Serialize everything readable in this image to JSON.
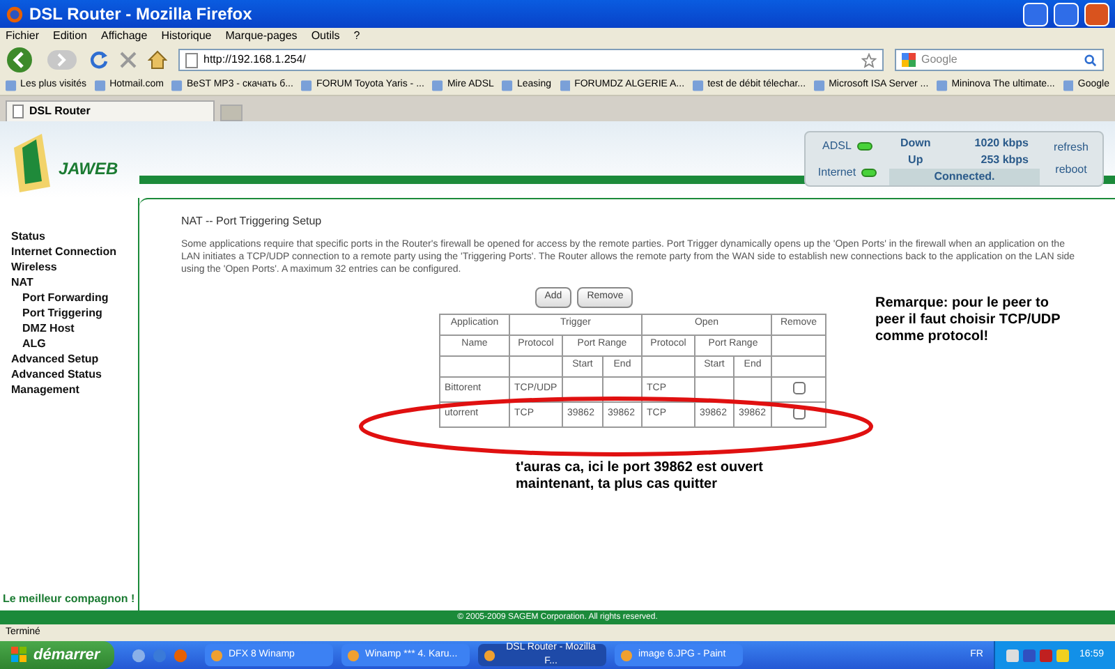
{
  "window": {
    "title": "DSL Router - Mozilla Firefox"
  },
  "menu": [
    "Fichier",
    "Edition",
    "Affichage",
    "Historique",
    "Marque-pages",
    "Outils",
    "?"
  ],
  "navigation": {
    "url": "http://192.168.1.254/",
    "search_placeholder": "Google"
  },
  "bookmarks": [
    "Les plus visités",
    "Hotmail.com",
    "BeST MP3 - скачать б...",
    "FORUM Toyota Yaris - ...",
    "Mire ADSL",
    "Leasing",
    "FORUMDZ ALGERIE A...",
    "test de débit télechar...",
    "Microsoft ISA Server ...",
    "Mininova  The ultimate...",
    "Google"
  ],
  "tabs": [
    {
      "label": "DSL Router",
      "selected": true
    }
  ],
  "router": {
    "logo": "JAWEB",
    "status": {
      "adsl_label": "ADSL",
      "internet_label": "Internet",
      "down_label": "Down",
      "down_value": "1020 kbps",
      "up_label": "Up",
      "up_value": "253 kbps",
      "connection": "Connected.",
      "buttons": [
        "refresh",
        "reboot"
      ]
    },
    "sidebar": {
      "items": [
        {
          "label": "Status"
        },
        {
          "label": "Internet Connection"
        },
        {
          "label": "Wireless"
        },
        {
          "label": "NAT",
          "children": [
            {
              "label": "Port Forwarding"
            },
            {
              "label": "Port Triggering"
            },
            {
              "label": "DMZ Host"
            },
            {
              "label": "ALG"
            }
          ]
        },
        {
          "label": "Advanced Setup"
        },
        {
          "label": "Advanced Status"
        },
        {
          "label": "Management"
        }
      ],
      "slogan": "Le meilleur compagnon !"
    },
    "page_title": "NAT -- Port Triggering Setup",
    "description": "Some applications require that specific ports in the Router's firewall be opened for access by the remote parties. Port Trigger dynamically opens up the 'Open Ports' in the firewall when an application on the LAN initiates a TCP/UDP connection to a remote party using the 'Triggering Ports'. The Router allows the remote party from the WAN side to establish new connections back to the application on the LAN side using the 'Open Ports'. A maximum 32 entries can be configured.",
    "buttons": [
      "Add",
      "Remove"
    ],
    "table": {
      "header": {
        "application": "Application",
        "trigger": "Trigger",
        "open": "Open",
        "remove": "Remove",
        "name": "Name",
        "trigger_protocol": "Protocol",
        "trigger_port_range": "Port Range",
        "open_protocol": "Protocol",
        "open_port_range": "Port Range",
        "trigger_start": "Start",
        "trigger_end": "End",
        "open_start": "Start",
        "open_end": "End"
      },
      "rows": [
        {
          "name": "Bittorent",
          "trigger_protocol": "TCP/UDP",
          "open_protocol": "TCP",
          "checked": false
        },
        {
          "name": "utorrent",
          "trigger_protocol": "TCP",
          "trigger_start": "39862",
          "trigger_end": "39862",
          "open_protocol": "TCP",
          "open_start": "39862",
          "open_end": "39862",
          "checked": false
        }
      ]
    },
    "footer": "© 2005-2009 SAGEM Corporation. All rights reserved."
  },
  "annotations": {
    "note": "Remarque: pour le peer to peer il faut choisir TCP/UDP comme protocol!",
    "comment": "t'auras ca, ici le port 39862 est ouvert maintenant, ta plus cas quitter"
  },
  "status_bar": "Terminé",
  "taskbar": {
    "start": "démarrer",
    "tasks": [
      {
        "label": "DFX 8 Winamp",
        "selected": false
      },
      {
        "label": "Winamp *** 4. Karu...",
        "selected": false
      },
      {
        "label": "DSL Router - Mozilla F...",
        "selected": true
      },
      {
        "label": "image 6.JPG - Paint",
        "selected": false
      }
    ],
    "language": "FR",
    "clock": "16:59"
  }
}
